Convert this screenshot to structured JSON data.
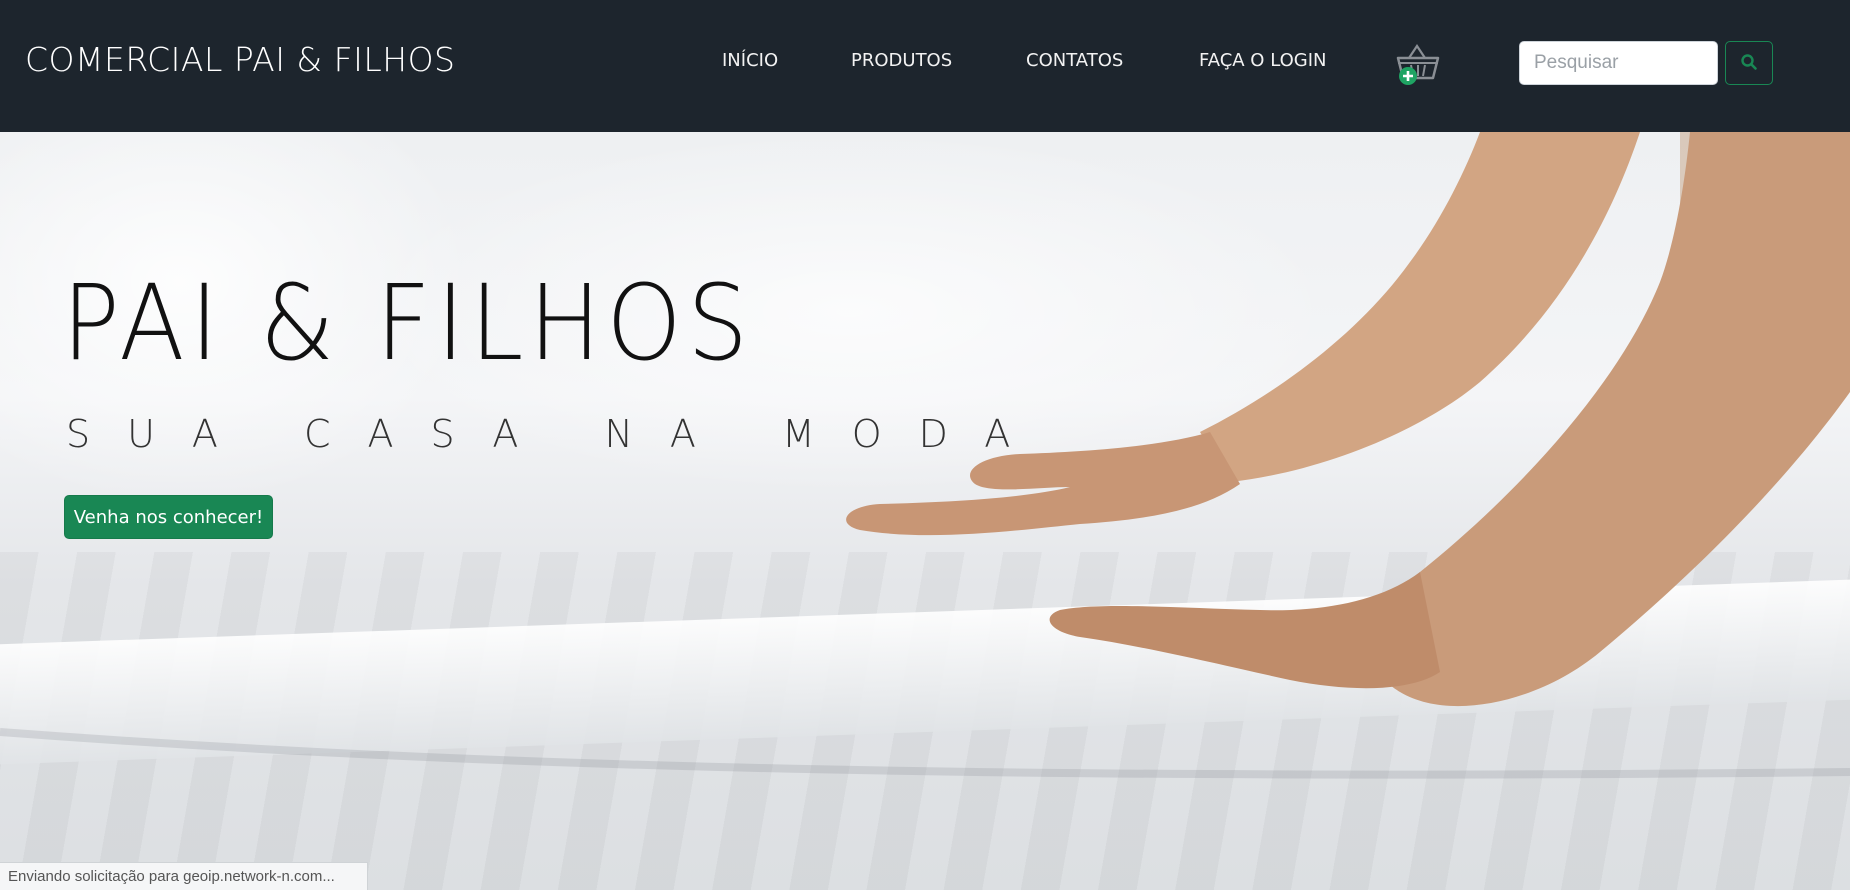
{
  "navbar": {
    "brand": "COMERCIAL PAI & FILHOS",
    "links": [
      {
        "label": "INÍCIO"
      },
      {
        "label": "PRODUTOS"
      },
      {
        "label": "CONTATOS"
      },
      {
        "label": "FAÇA O LOGIN"
      }
    ],
    "cart_icon": "shopping-basket-add-icon",
    "search": {
      "placeholder": "Pesquisar",
      "value": ""
    },
    "search_button_icon": "search-icon"
  },
  "hero": {
    "title": "PAI & FILHOS",
    "subtitle": "SUA CASA NA MODA",
    "cta_label": "Venha nos conhecer!"
  },
  "status_bar": {
    "text": "Enviando solicitação para geoip.network-n.com..."
  },
  "colors": {
    "navbar_bg": "#1d252d",
    "accent_green": "#198754",
    "text_white": "#ffffff"
  }
}
